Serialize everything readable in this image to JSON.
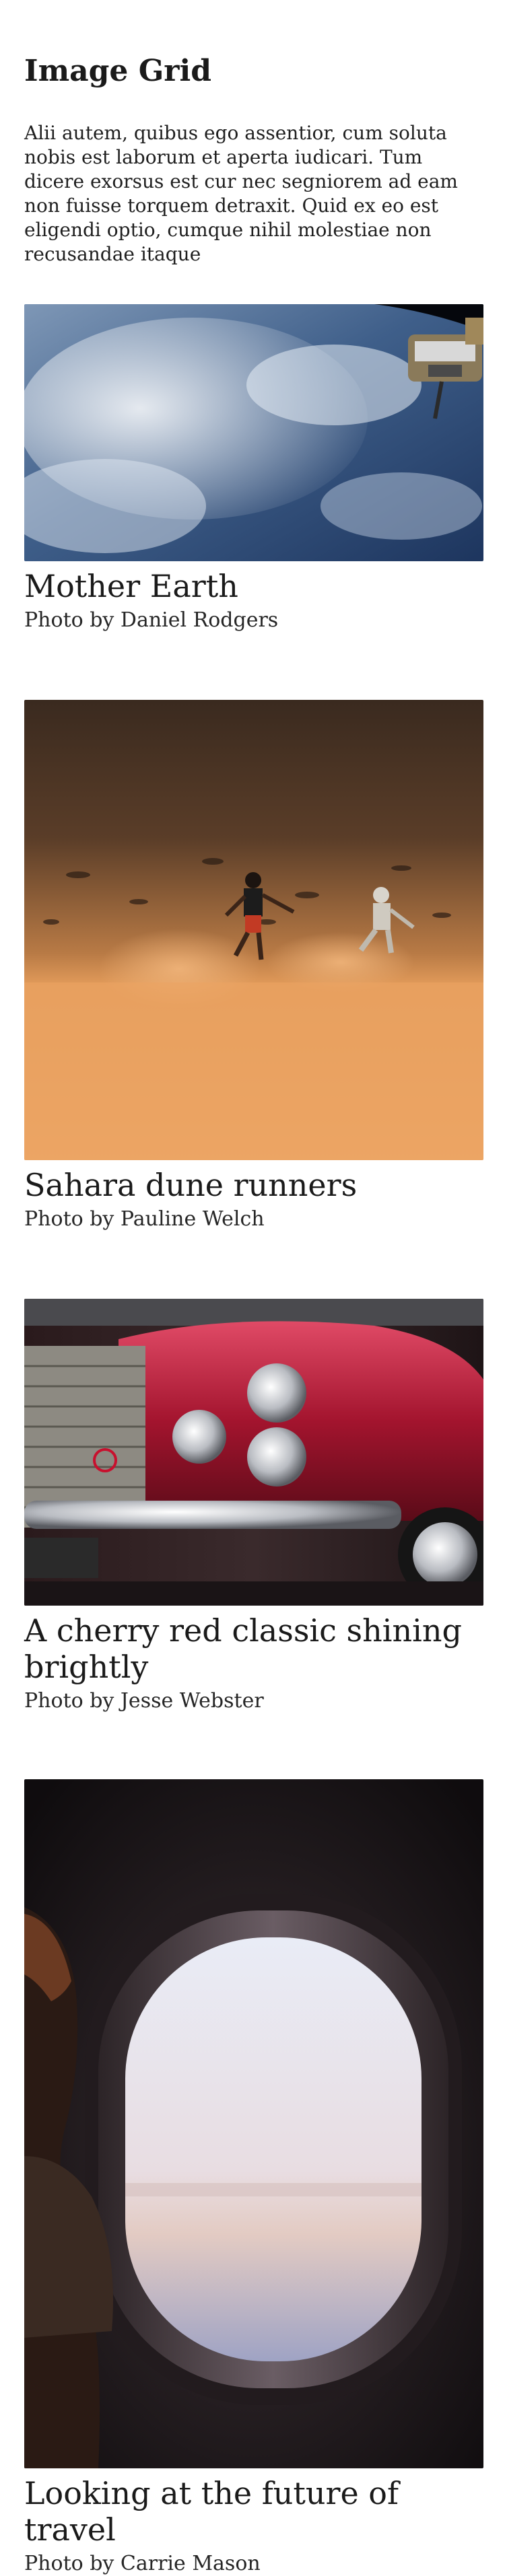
{
  "header": {
    "title": "Image Grid",
    "intro": "Alii autem, quibus ego assentior, cum soluta nobis est laborum et aperta iudicari. Tum dicere exorsus est cur nec segniorem ad eam non fuisse torquem detraxit. Quid ex eo est eligendi optio, cumque nihil molestiae non recusandae itaque"
  },
  "photos": [
    {
      "title": "Mother Earth",
      "credit": "Photo by Daniel Rodgers"
    },
    {
      "title": "Sahara dune runners",
      "credit": "Photo by Pauline Welch"
    },
    {
      "title": "A cherry red classic shining brightly",
      "credit": "Photo by Jesse Webster"
    },
    {
      "title": "Looking at the future of travel",
      "credit": "Photo by Carrie Mason"
    }
  ]
}
